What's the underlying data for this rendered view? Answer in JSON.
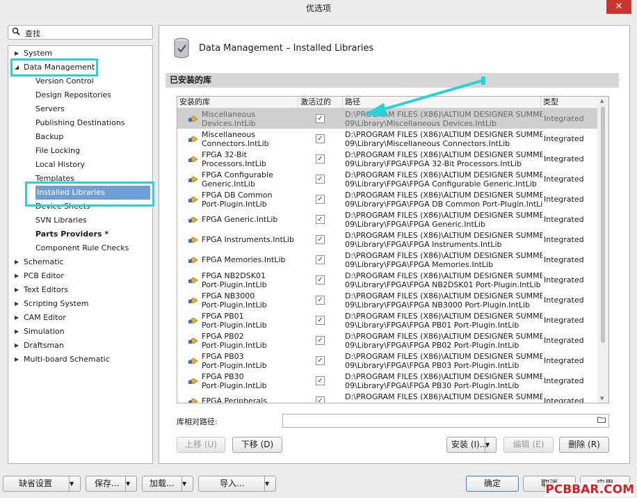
{
  "window": {
    "title": "优选项",
    "close_icon": "✕"
  },
  "search": {
    "placeholder": "查找"
  },
  "tree": [
    {
      "label": "System",
      "arrow": "▶",
      "bold": false,
      "selected": false
    },
    {
      "label": "Data Management",
      "arrow": "◢",
      "bold": false,
      "selected": false
    },
    {
      "label": "Version Control",
      "arrow": "",
      "bold": false,
      "selected": false
    },
    {
      "label": "Design Repositories",
      "arrow": "",
      "bold": false,
      "selected": false
    },
    {
      "label": "Servers",
      "arrow": "",
      "bold": false,
      "selected": false
    },
    {
      "label": "Publishing Destinations",
      "arrow": "",
      "bold": false,
      "selected": false
    },
    {
      "label": "Backup",
      "arrow": "",
      "bold": false,
      "selected": false
    },
    {
      "label": "File Locking",
      "arrow": "",
      "bold": false,
      "selected": false
    },
    {
      "label": "Local History",
      "arrow": "",
      "bold": false,
      "selected": false
    },
    {
      "label": "Templates",
      "arrow": "",
      "bold": false,
      "selected": false
    },
    {
      "label": "Installed Libraries",
      "arrow": "",
      "bold": false,
      "selected": true
    },
    {
      "label": "Device Sheets",
      "arrow": "",
      "bold": false,
      "selected": false
    },
    {
      "label": "SVN Libraries",
      "arrow": "",
      "bold": false,
      "selected": false
    },
    {
      "label": "Parts Providers *",
      "arrow": "",
      "bold": true,
      "selected": false
    },
    {
      "label": "Component Rule Checks",
      "arrow": "",
      "bold": false,
      "selected": false
    },
    {
      "label": "Schematic",
      "arrow": "▶",
      "bold": false,
      "selected": false
    },
    {
      "label": "PCB Editor",
      "arrow": "▶",
      "bold": false,
      "selected": false
    },
    {
      "label": "Text Editors",
      "arrow": "▶",
      "bold": false,
      "selected": false
    },
    {
      "label": "Scripting System",
      "arrow": "▶",
      "bold": false,
      "selected": false
    },
    {
      "label": "CAM Editor",
      "arrow": "▶",
      "bold": false,
      "selected": false
    },
    {
      "label": "Simulation",
      "arrow": "▶",
      "bold": false,
      "selected": false
    },
    {
      "label": "Draftsman",
      "arrow": "▶",
      "bold": false,
      "selected": false
    },
    {
      "label": "Multi-board Schematic",
      "arrow": "▶",
      "bold": false,
      "selected": false
    }
  ],
  "panel": {
    "title": "Data Management – Installed Libraries",
    "section": "已安装的库",
    "columns": [
      "安装的库",
      "激活过的",
      "路径",
      "类型"
    ],
    "check_glyph": "✓",
    "rows": [
      {
        "name": [
          "Miscellaneous",
          "Devices.IntLib"
        ],
        "path": [
          "D:\\PROGRAM FILES (X86)\\ALTIUM DESIGNER SUMMER",
          "09\\Library\\Miscellaneous Devices.IntLib"
        ],
        "type": "Integrated",
        "selected": true
      },
      {
        "name": [
          "Miscellaneous",
          "Connectors.IntLib"
        ],
        "path": [
          "D:\\PROGRAM FILES (X86)\\ALTIUM DESIGNER SUMMER",
          "09\\Library\\Miscellaneous Connectors.IntLib"
        ],
        "type": "Integrated",
        "selected": false
      },
      {
        "name": [
          "FPGA 32-Bit",
          "Processors.IntLib"
        ],
        "path": [
          "D:\\PROGRAM FILES (X86)\\ALTIUM DESIGNER SUMMER",
          "09\\Library\\FPGA\\FPGA 32-Bit Processors.IntLib"
        ],
        "type": "Integrated",
        "selected": false
      },
      {
        "name": [
          "FPGA Configurable",
          "Generic.IntLib"
        ],
        "path": [
          "D:\\PROGRAM FILES (X86)\\ALTIUM DESIGNER SUMMER",
          "09\\Library\\FPGA\\FPGA Configurable Generic.IntLib"
        ],
        "type": "Integrated",
        "selected": false
      },
      {
        "name": [
          "FPGA DB Common",
          "Port-Plugin.IntLib"
        ],
        "path": [
          "D:\\PROGRAM FILES (X86)\\ALTIUM DESIGNER SUMMER",
          "09\\Library\\FPGA\\FPGA DB Common Port-Plugin.IntLib"
        ],
        "type": "Integrated",
        "selected": false
      },
      {
        "name": [
          "FPGA Generic.IntLib",
          ""
        ],
        "path": [
          "D:\\PROGRAM FILES (X86)\\ALTIUM DESIGNER SUMMER",
          "09\\Library\\FPGA\\FPGA Generic.IntLib"
        ],
        "type": "Integrated",
        "selected": false
      },
      {
        "name": [
          "FPGA Instruments.IntLib",
          ""
        ],
        "path": [
          "D:\\PROGRAM FILES (X86)\\ALTIUM DESIGNER SUMMER",
          "09\\Library\\FPGA\\FPGA Instruments.IntLib"
        ],
        "type": "Integrated",
        "selected": false
      },
      {
        "name": [
          "FPGA Memories.IntLib",
          ""
        ],
        "path": [
          "D:\\PROGRAM FILES (X86)\\ALTIUM DESIGNER SUMMER",
          "09\\Library\\FPGA\\FPGA Memories.IntLib"
        ],
        "type": "Integrated",
        "selected": false
      },
      {
        "name": [
          "FPGA NB2DSK01",
          "Port-Plugin.IntLib"
        ],
        "path": [
          "D:\\PROGRAM FILES (X86)\\ALTIUM DESIGNER SUMMER",
          "09\\Library\\FPGA\\FPGA NB2DSK01 Port-Plugin.IntLib"
        ],
        "type": "Integrated",
        "selected": false
      },
      {
        "name": [
          "FPGA NB3000",
          "Port-Plugin.IntLib"
        ],
        "path": [
          "D:\\PROGRAM FILES (X86)\\ALTIUM DESIGNER SUMMER",
          "09\\Library\\FPGA\\FPGA NB3000 Port-Plugin.IntLib"
        ],
        "type": "Integrated",
        "selected": false
      },
      {
        "name": [
          "FPGA PB01",
          "Port-Plugin.IntLib"
        ],
        "path": [
          "D:\\PROGRAM FILES (X86)\\ALTIUM DESIGNER SUMMER",
          "09\\Library\\FPGA\\FPGA PB01 Port-Plugin.IntLib"
        ],
        "type": "Integrated",
        "selected": false
      },
      {
        "name": [
          "FPGA PB02",
          "Port-Plugin.IntLib"
        ],
        "path": [
          "D:\\PROGRAM FILES (X86)\\ALTIUM DESIGNER SUMMER",
          "09\\Library\\FPGA\\FPGA PB02 Port-Plugin.IntLib"
        ],
        "type": "Integrated",
        "selected": false
      },
      {
        "name": [
          "FPGA PB03",
          "Port-Plugin.IntLib"
        ],
        "path": [
          "D:\\PROGRAM FILES (X86)\\ALTIUM DESIGNER SUMMER",
          "09\\Library\\FPGA\\FPGA PB03 Port-Plugin.IntLib"
        ],
        "type": "Integrated",
        "selected": false
      },
      {
        "name": [
          "FPGA PB30",
          "Port-Plugin.IntLib"
        ],
        "path": [
          "D:\\PROGRAM FILES (X86)\\ALTIUM DESIGNER SUMMER",
          "09\\Library\\FPGA\\FPGA PB30 Port-Plugin.IntLib"
        ],
        "type": "Integrated",
        "selected": false
      },
      {
        "name": [
          "FPGA Peripherals",
          ""
        ],
        "path": [
          "D:\\PROGRAM FILES (X86)\\ALTIUM DESIGNER SUMMER",
          ""
        ],
        "type": "Integrated",
        "selected": false
      }
    ],
    "rel_path_label": "库相对路径:",
    "rel_path_value": "",
    "buttons": {
      "move_up": "上移 (U)",
      "move_down": "下移 (D)",
      "install": "安装 (I)...",
      "edit": "编辑 (E)",
      "remove": "删除 (R)"
    }
  },
  "footer": {
    "defaults": "缺省设置",
    "save": "保存...",
    "load": "加载...",
    "import": "导入...",
    "ok": "确定",
    "cancel": "取消",
    "apply": "应用"
  },
  "watermark": "PCBBAR.COM",
  "colors": {
    "highlight": "#27d3d9",
    "selected_tree": "#6f9fd4",
    "close": "#c7372d"
  }
}
